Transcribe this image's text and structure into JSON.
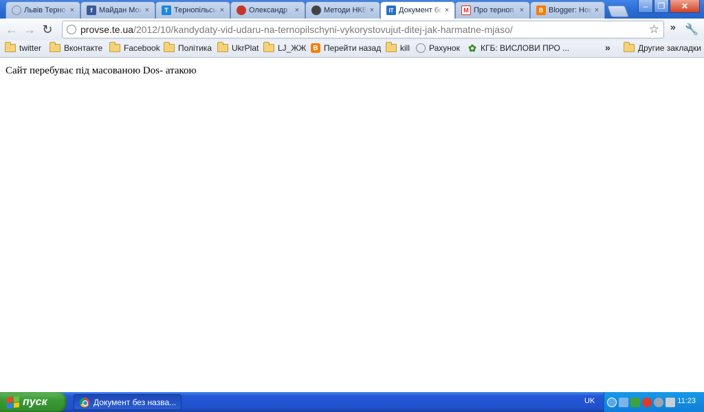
{
  "tabs": [
    {
      "label": "Львів Терно",
      "icon": "globe-icon",
      "color": "#8a8a8a"
    },
    {
      "label": "Майдан Мон",
      "icon": "facebook-icon",
      "color": "#3b5998"
    },
    {
      "label": "Тернопільсь",
      "icon": "t-logo-icon",
      "color": "#1e88d8"
    },
    {
      "label": "Олександр",
      "icon": "opera-icon",
      "color": "#c0392b"
    },
    {
      "label": "Методи НКВ",
      "icon": "opera-icon",
      "color": "#444444"
    },
    {
      "label": "Документ бе",
      "icon": "document-icon",
      "color": "#2a70c4",
      "active": true
    },
    {
      "label": "Про терноп",
      "icon": "gmail-icon",
      "color": "#d93025"
    },
    {
      "label": "Blogger: Нов",
      "icon": "blogger-icon",
      "color": "#f57d00"
    }
  ],
  "tab_close": "×",
  "address": {
    "host": "provse.te.ua",
    "path": "/2012/10/kandydaty-vid-udaru-na-ternopilschyni-vykorystovujut-ditej-jak-harmatne-mjaso/"
  },
  "toolbar": {
    "more": "»"
  },
  "bookmarks": [
    {
      "label": "twitter",
      "icon": "folder-icon"
    },
    {
      "label": "Вконтакте",
      "icon": "folder-icon"
    },
    {
      "label": "Facebook",
      "icon": "folder-icon"
    },
    {
      "label": "Політика",
      "icon": "folder-icon"
    },
    {
      "label": "UkrPlat",
      "icon": "folder-icon"
    },
    {
      "label": "LJ_ЖЖ",
      "icon": "folder-icon"
    },
    {
      "label": "Перейти назад",
      "icon": "blogger-icon"
    },
    {
      "label": "kill",
      "icon": "folder-icon"
    },
    {
      "label": "Рахунок",
      "icon": "globe-icon"
    },
    {
      "label": "КГБ: ВИСЛОВИ ПРО ...",
      "icon": "leaf-icon"
    }
  ],
  "bookmarks_more": "»",
  "other_bookmarks": "Другие закладки",
  "page": {
    "message": "Сайт перебуває під масованою Dos- атакою"
  },
  "taskbar": {
    "start": "пуск",
    "window": "Документ без назва...",
    "lang": "UK",
    "clock": "11:23"
  }
}
